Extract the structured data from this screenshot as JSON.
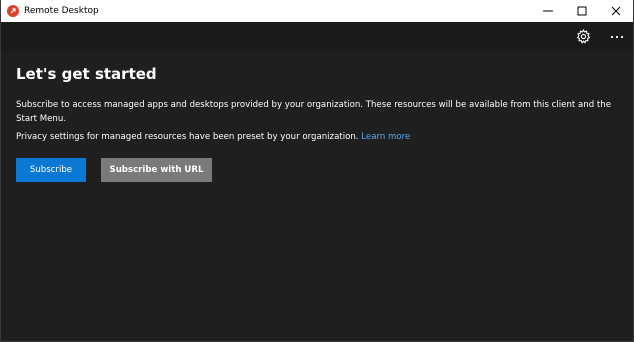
{
  "window": {
    "title": "Remote Desktop",
    "app_icon": "remote-desktop-icon",
    "accent_color": "#d9432b",
    "controls": [
      "minimize-icon",
      "maximize-icon",
      "close-icon"
    ]
  },
  "appbar": {
    "icons": [
      "gear-icon",
      "more-icon"
    ]
  },
  "main": {
    "heading": "Let's get started",
    "description": "Subscribe to access managed apps and desktops provided by your organization. These resources will be available from this client and the Start Menu.",
    "privacy_text": "Privacy settings for managed resources have been preset by your organization. ",
    "learn_more": "Learn more",
    "link_color": "#5aa8ee",
    "buttons": {
      "subscribe": "Subscribe",
      "subscribe_color": "#0b78d4",
      "subscribe_url": "Subscribe with URL",
      "subscribe_url_color": "#7a7a7a"
    }
  }
}
